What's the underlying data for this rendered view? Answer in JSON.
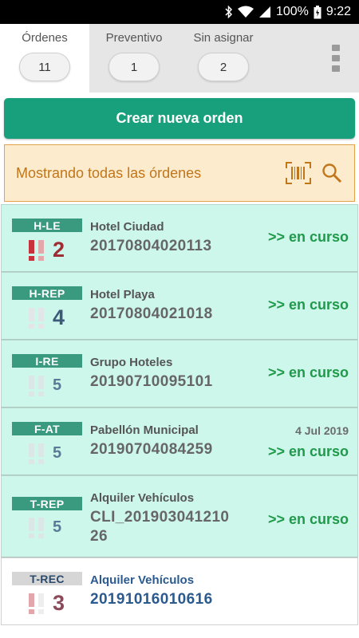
{
  "statusbar": {
    "battery": "100%",
    "time": "9:22"
  },
  "tabs": [
    {
      "label": "Órdenes",
      "count": "11"
    },
    {
      "label": "Preventivo",
      "count": "1"
    },
    {
      "label": "Sin asignar",
      "count": "2"
    }
  ],
  "create_button": "Crear nueva orden",
  "filter": {
    "text": "Mostrando todas las órdenes"
  },
  "orders": [
    {
      "badge": "H-LE",
      "priority": "2",
      "client": "Hotel Ciudad",
      "code": "20170804020113",
      "date": "",
      "status": ">> en curso"
    },
    {
      "badge": "H-REP",
      "priority": "4",
      "client": "Hotel Playa",
      "code": "20170804021018",
      "date": "",
      "status": ">> en curso"
    },
    {
      "badge": "I-RE",
      "priority": "5",
      "client": "Grupo Hoteles",
      "code": "20190710095101",
      "date": "",
      "status": ">> en curso"
    },
    {
      "badge": "F-AT",
      "priority": "5",
      "client": "Pabellón Municipal",
      "code": "20190704084259",
      "date": "4 Jul 2019",
      "status": ">> en curso"
    },
    {
      "badge": "T-REP",
      "priority": "5",
      "client": "Alquiler Vehículos",
      "code": "CLI_201903041210 26",
      "date": "",
      "status": ">> en curso"
    },
    {
      "badge": "T-REC",
      "priority": "3",
      "client": "Alquiler Vehículos",
      "code": "20191016010616",
      "date": "",
      "status": ""
    }
  ],
  "colors": {
    "accent": "#17a07b",
    "badge": "#3a9a7f",
    "status_green": "#1f9a4a",
    "filter_bg": "#fdebcd",
    "filter_text": "#c0761b",
    "prio_high": "#a02c34",
    "prio_mid": "#3c5a78"
  }
}
